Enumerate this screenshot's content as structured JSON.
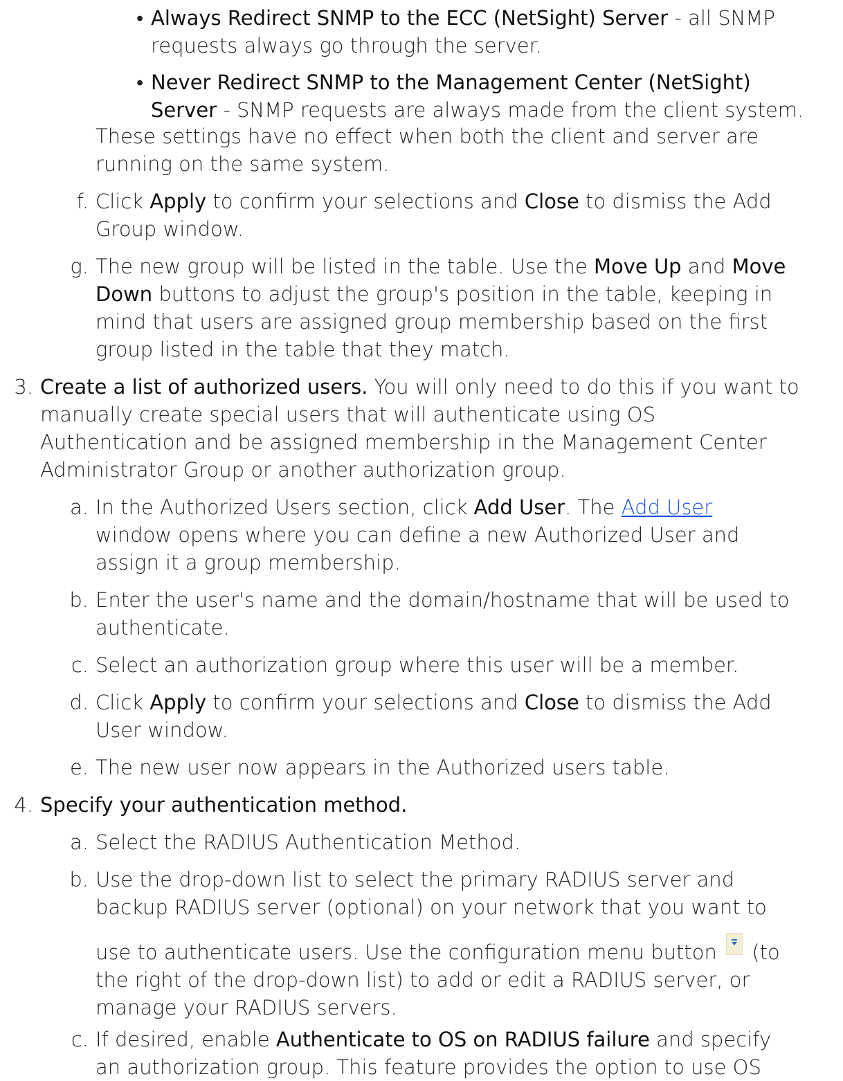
{
  "bullets": [
    {
      "bold": "Always Redirect SNMP to the ECC (NetSight) Server",
      "rest1": " - all SNMP",
      "rest2": "requests always go through the server."
    },
    {
      "bold1": "Never Redirect SNMP to the Management Center (NetSight)",
      "bold2": "Server",
      "rest": " - SNMP requests are always made from the client system."
    }
  ],
  "note": [
    "These settings have no effect when both the client and server are",
    "running on the same system."
  ],
  "step2": {
    "f": {
      "marker": "f.",
      "t1": "Click ",
      "b1": "Apply",
      "t2": " to confirm your selections and ",
      "b2": "Close",
      "t3": " to dismiss the Add",
      "line2": "Group window."
    },
    "g": {
      "marker": "g.",
      "t1": "The new group will be listed in the table. Use the ",
      "b1": "Move Up",
      "t2": " and ",
      "b2": "Move",
      "b3": "Down",
      "t3": " buttons to adjust the group's position in the table, keeping in",
      "line3": "mind that users are assigned group membership based on the first",
      "line4": "group listed in the table that they match."
    }
  },
  "step3": {
    "marker": "3.",
    "bold": "Create a list of authorized users.",
    "t1": " You will only need to do this if you want to",
    "lines": [
      "manually create special users that will authenticate using OS",
      "Authentication and be assigned membership in the Management Center",
      "Administrator Group or another authorization group."
    ],
    "a": {
      "marker": "a.",
      "t1": "In the Authorized Users section, click ",
      "b1": "Add User",
      "t2": ". The ",
      "link": "Add User",
      "line2": "window opens where you can define a new Authorized User and",
      "line3": "assign it a group membership."
    },
    "b": {
      "marker": "b.",
      "line1": "Enter the user's name and the domain/hostname that will be used to",
      "line2": "authenticate."
    },
    "c": {
      "marker": "c.",
      "line1": "Select an authorization group where this user will be a member."
    },
    "d": {
      "marker": "d.",
      "t1": "Click ",
      "b1": "Apply",
      "t2": " to confirm your selections and ",
      "b2": "Close",
      "t3": " to dismiss the Add",
      "line2": "User window."
    },
    "e": {
      "marker": "e.",
      "line1": "The new user now appears in the Authorized users table."
    }
  },
  "step4": {
    "marker": "4.",
    "bold": "Specify your authentication method.",
    "a": {
      "marker": "a.",
      "line1": "Select the RADIUS Authentication Method."
    },
    "b": {
      "marker": "b.",
      "line1": "Use the drop-down list to select the primary RADIUS server  and",
      "line2": "backup RADIUS server (optional) on your network that you want to",
      "line3a": "use to authenticate users. Use the configuration menu button ",
      "line3b": " (to",
      "line4": "the right of the drop-down list) to add or edit a RADIUS server, or",
      "line5": "manage your RADIUS servers."
    },
    "c": {
      "marker": "c.",
      "t1": "If desired, enable ",
      "b1": "Authenticate to OS on RADIUS failure",
      "t2": " and specify",
      "line2": "an authorization group. This feature provides the option to use OS"
    }
  },
  "icons": {
    "config_menu": "configuration-menu-icon"
  }
}
